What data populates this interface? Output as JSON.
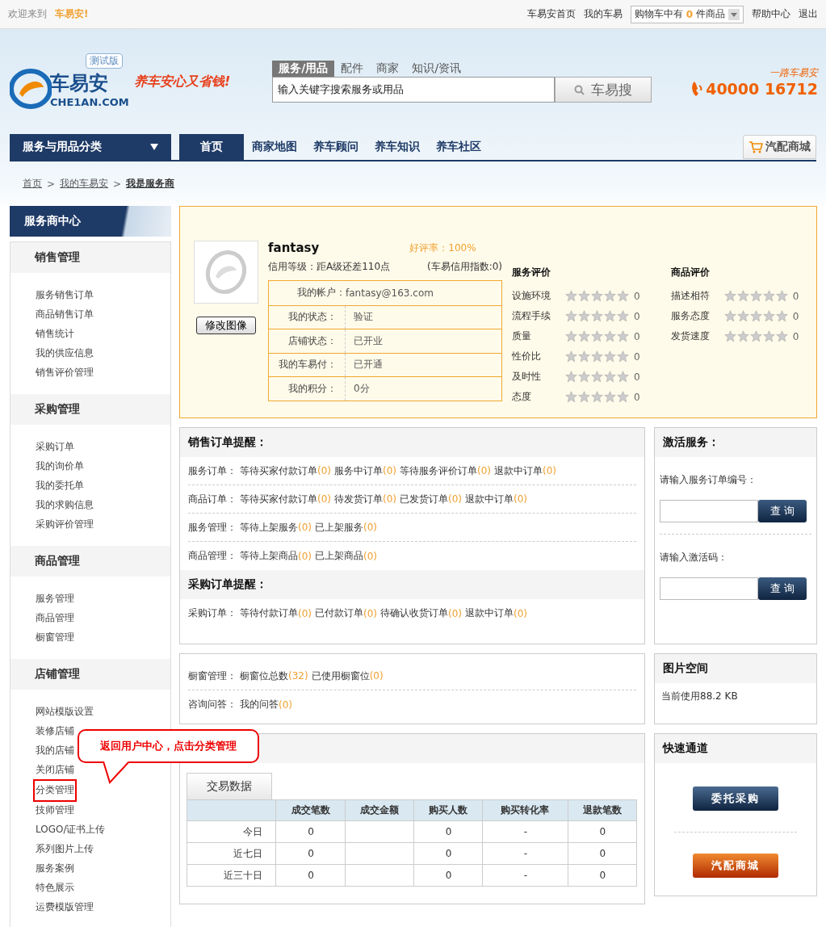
{
  "topbar": {
    "welcome": "欢迎来到",
    "brand": "车易安!",
    "links": [
      "车易安首页",
      "我的车易"
    ],
    "cart": {
      "prefix": "购物车中有",
      "count": "0",
      "suffix": "件商品"
    },
    "links_right": [
      "帮助中心",
      "退出"
    ]
  },
  "header": {
    "logo_text": "车易安",
    "logo_domain": "CHE1AN.COM",
    "badge": "测试版",
    "slogan": "养车安心又省钱!",
    "search_tabs": [
      {
        "label": "服务/用品",
        "selected": true
      },
      {
        "label": "配件",
        "selected": false
      },
      {
        "label": "商家",
        "selected": false
      },
      {
        "label": "知识/资讯",
        "selected": false
      }
    ],
    "search_value": "输入关键字搜索服务或用品",
    "search_button": "车易搜",
    "hotline_caption": "一路车易安",
    "hotline": "40000 16712"
  },
  "nav": {
    "category": "服务与用品分类",
    "items": [
      {
        "label": "首页",
        "selected": true
      },
      {
        "label": "商家地图",
        "selected": false
      },
      {
        "label": "养车顾问",
        "selected": false
      },
      {
        "label": "养车知识",
        "selected": false
      },
      {
        "label": "养车社区",
        "selected": false
      }
    ],
    "mall": "汽配商城"
  },
  "breadcrumb": [
    {
      "label": "首页",
      "current": false
    },
    {
      "separator": ">",
      "label": "我的车易安",
      "current": false
    },
    {
      "separator": ">",
      "label": "我是服务商",
      "current": true
    }
  ],
  "sidebar": {
    "title": "服务商中心",
    "groups": [
      {
        "title": "销售管理",
        "items": [
          {
            "label": "服务销售订单",
            "marked": false
          },
          {
            "label": "商品销售订单",
            "marked": false
          },
          {
            "label": "销售统计",
            "marked": false
          },
          {
            "label": "我的供应信息",
            "marked": false
          },
          {
            "label": "销售评价管理",
            "marked": false
          }
        ]
      },
      {
        "title": "采购管理",
        "items": [
          {
            "label": "采购订单",
            "marked": false
          },
          {
            "label": "我的询价单",
            "marked": false
          },
          {
            "label": "我的委托单",
            "marked": false
          },
          {
            "label": "我的求购信息",
            "marked": false
          },
          {
            "label": "采购评价管理",
            "marked": false
          }
        ]
      },
      {
        "title": "商品管理",
        "items": [
          {
            "label": "服务管理",
            "marked": false
          },
          {
            "label": "商品管理",
            "marked": false
          },
          {
            "label": "橱窗管理",
            "marked": false
          }
        ]
      },
      {
        "title": "店铺管理",
        "items": [
          {
            "label": "网站模版设置",
            "marked": false
          },
          {
            "label": "装修店铺",
            "marked": false
          },
          {
            "label": "我的店铺",
            "marked": false
          },
          {
            "label": "关闭店铺",
            "marked": false
          },
          {
            "label": "分类管理",
            "marked": true
          },
          {
            "label": "技师管理",
            "marked": false
          },
          {
            "label": "LOGO/证书上传",
            "marked": false
          },
          {
            "label": "系列图片上传",
            "marked": false
          },
          {
            "label": "服务案例",
            "marked": false
          },
          {
            "label": "特色展示",
            "marked": false
          },
          {
            "label": "运费模版管理",
            "marked": false
          }
        ]
      }
    ]
  },
  "callout": "返回用户中心，点击分类管理",
  "profile": {
    "name": "fantasy",
    "rating": "好评率：100%",
    "credit": "信用等级：距A级还差110点",
    "credit_index": "(车易信用指数:0)",
    "edit_button": "修改图像",
    "account": [
      {
        "label": "我的帐户：",
        "value": "fantasy@163.com"
      },
      {
        "label": "我的状态：",
        "value": "验证"
      },
      {
        "label": "店铺状态：",
        "value": "已开业"
      },
      {
        "label": "我的车易付：",
        "value": "已开通"
      },
      {
        "label": "我的积分：",
        "value": "0分"
      }
    ],
    "ratings": [
      {
        "title": "服务评价",
        "rows": [
          {
            "label": "设施环境",
            "stars": 0,
            "count": "0"
          },
          {
            "label": "流程手续",
            "stars": 0,
            "count": "0"
          },
          {
            "label": "质量",
            "stars": 0,
            "count": "0"
          },
          {
            "label": "性价比",
            "stars": 0,
            "count": "0"
          },
          {
            "label": "及时性",
            "stars": 0,
            "count": "0"
          },
          {
            "label": "态度",
            "stars": 0,
            "count": "0"
          }
        ]
      },
      {
        "title": "商品评价",
        "rows": [
          {
            "label": "描述相符",
            "stars": 0,
            "count": "0"
          },
          {
            "label": "服务态度",
            "stars": 0,
            "count": "0"
          },
          {
            "label": "发货速度",
            "stars": 0,
            "count": "0"
          }
        ]
      }
    ]
  },
  "reminders": [
    {
      "title": "销售订单提醒：",
      "rows": [
        {
          "label": "服务订单：",
          "items": [
            {
              "text": "等待买家付款订单",
              "count": "(0)"
            },
            {
              "text": "服务中订单",
              "count": "(0)"
            },
            {
              "text": "等待服务评价订单",
              "count": "(0)"
            },
            {
              "text": "退款中订单",
              "count": "(0)"
            }
          ]
        },
        {
          "label": "商品订单：",
          "items": [
            {
              "text": "等待买家付款订单",
              "count": "(0)"
            },
            {
              "text": "待发货订单",
              "count": "(0)"
            },
            {
              "text": "已发货订单",
              "count": "(0)"
            },
            {
              "text": "退款中订单",
              "count": "(0)"
            }
          ]
        },
        {
          "label": "服务管理：",
          "items": [
            {
              "text": "等待上架服务",
              "count": "(0)"
            },
            {
              "text": "已上架服务",
              "count": "(0)"
            }
          ]
        },
        {
          "label": "商品管理：",
          "items": [
            {
              "text": "等待上架商品",
              "count": "(0)"
            },
            {
              "text": "已上架商品",
              "count": "(0)"
            }
          ]
        }
      ]
    },
    {
      "title": "采购订单提醒：",
      "rows": [
        {
          "label": "采购订单：",
          "items": [
            {
              "text": "等待付款订单",
              "count": "(0)"
            },
            {
              "text": "已付款订单",
              "count": "(0)"
            },
            {
              "text": "待确认收货订单",
              "count": "(0)"
            },
            {
              "text": "退款中订单",
              "count": "(0)"
            }
          ]
        }
      ]
    }
  ],
  "activate": {
    "title": "激活服务：",
    "fields": [
      {
        "label": "请输入服务订单编号：",
        "button": "查 询"
      },
      {
        "label": "请输入激活码：",
        "button": "查 询"
      }
    ]
  },
  "showcase": [
    {
      "label": "橱窗管理：",
      "items": [
        {
          "text": "橱窗位总数",
          "count": "(32)"
        },
        {
          "text": "已使用橱窗位",
          "count": "(0)"
        }
      ]
    },
    {
      "label": "咨询问答：",
      "items": [
        {
          "text": "我的问答",
          "count": "(0)"
        }
      ]
    }
  ],
  "picture_space": {
    "title": "图片空间",
    "usage": "当前使用88.2 KB"
  },
  "trade": {
    "tab": "交易数据",
    "columns": [
      "成交笔数",
      "成交金额",
      "购买人数",
      "购买转化率",
      "退款笔数"
    ],
    "rows": [
      {
        "label": "今日",
        "cells": [
          "0",
          "",
          "0",
          "-",
          "0"
        ]
      },
      {
        "label": "近七日",
        "cells": [
          "0",
          "",
          "0",
          "-",
          "0"
        ]
      },
      {
        "label": "近三十日",
        "cells": [
          "0",
          "",
          "0",
          "-",
          "0"
        ]
      }
    ]
  },
  "quick": {
    "title": "快速通道",
    "buttons": [
      {
        "label": "委托采购",
        "kind": "navy"
      },
      {
        "label": "汽配商城",
        "kind": "orange"
      }
    ]
  }
}
